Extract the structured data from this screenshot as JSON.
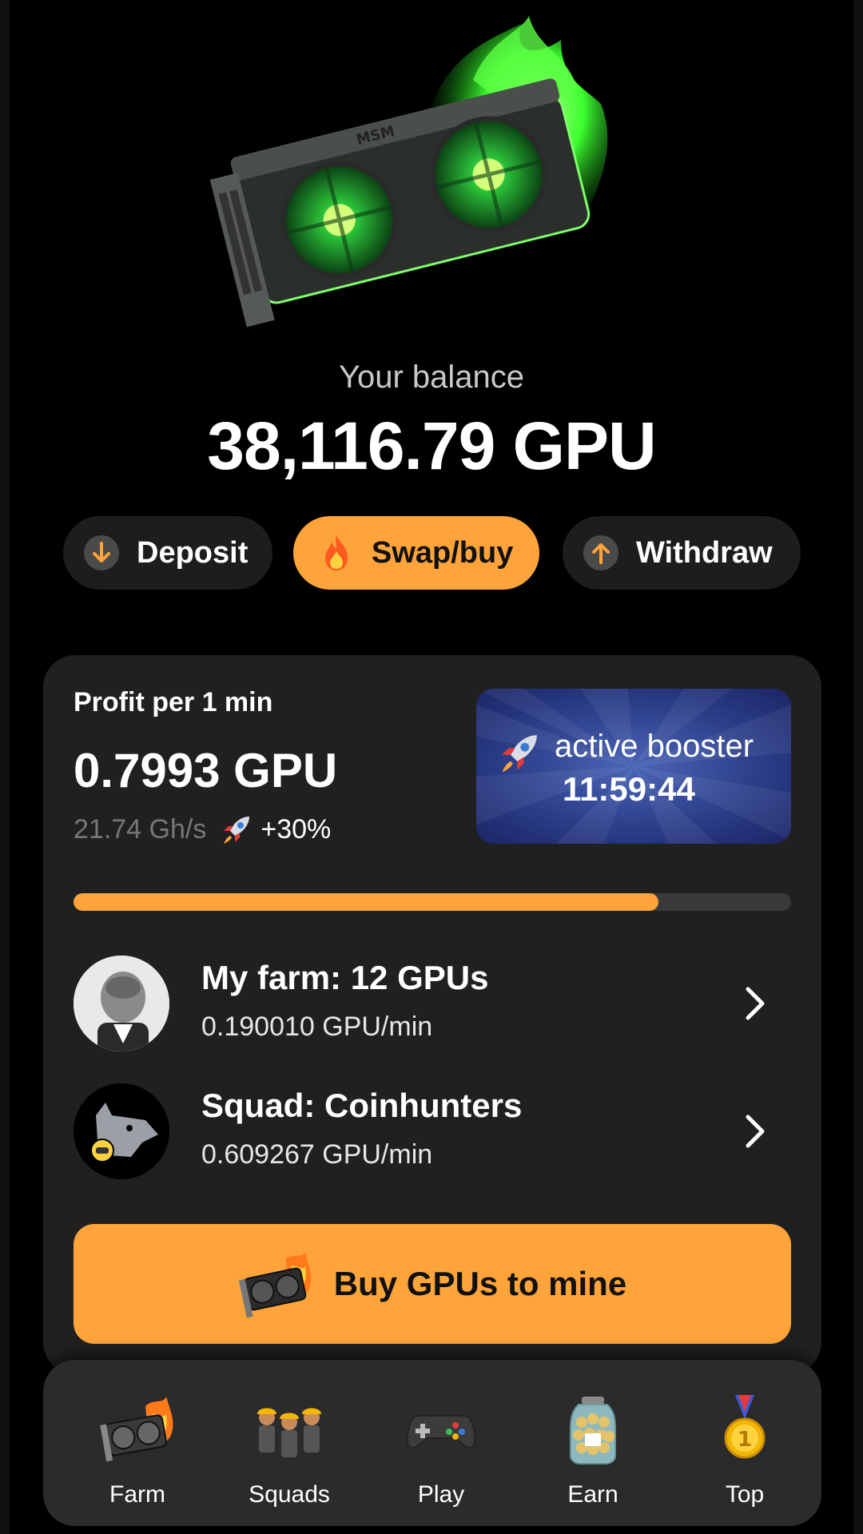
{
  "balance": {
    "label": "Your balance",
    "value": "38,116.79 GPU"
  },
  "actions": {
    "deposit": "Deposit",
    "swap": "Swap/buy",
    "withdraw": "Withdraw"
  },
  "profit": {
    "title": "Profit per 1 min",
    "value": "0.7993 GPU",
    "hashrate": "21.74 Gh/s",
    "boost": "+30%"
  },
  "booster": {
    "label": "active booster",
    "timer": "11:59:44"
  },
  "progress": {
    "fraction": 0.815
  },
  "farm": {
    "title": "My farm: 12 GPUs",
    "rate": "0.190010 GPU/min"
  },
  "squad": {
    "title": "Squad: Coinhunters",
    "rate": "0.609267 GPU/min"
  },
  "buy_button": "Buy GPUs to mine",
  "nav": {
    "farm": "Farm",
    "squads": "Squads",
    "play": "Play",
    "earn": "Earn",
    "top": "Top"
  },
  "colors": {
    "accent": "#ffa43a",
    "card": "#202020",
    "gpu_glow": "#39ff3a"
  }
}
